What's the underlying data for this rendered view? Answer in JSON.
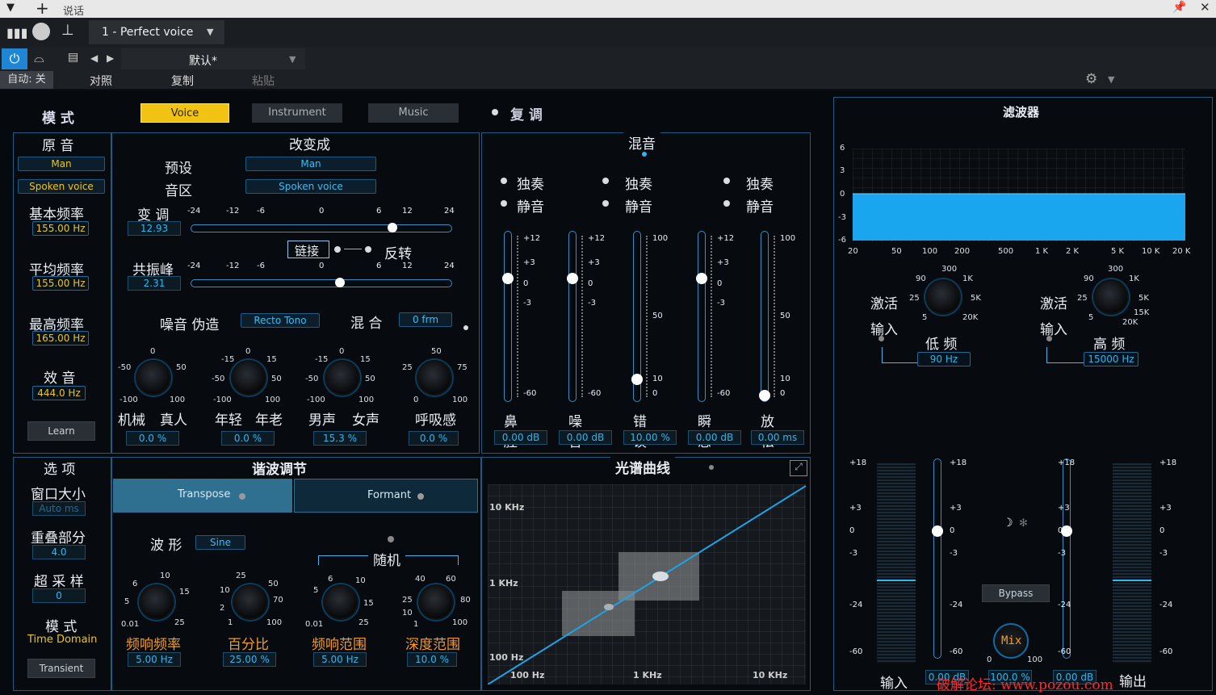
{
  "titlebar": {
    "title": "说话"
  },
  "toolbar": {
    "preset_slot": "1 - Perfect voice",
    "preset_name": "默认*",
    "auto": "自动: 关",
    "compare": "对照",
    "copy": "复制",
    "paste": "粘贴"
  },
  "mode": {
    "label": "模 式",
    "tabs": [
      "Voice",
      "Instrument",
      "Music"
    ],
    "active": "Voice",
    "reset": "复 调"
  },
  "source": {
    "title": "原 音",
    "gender": "Man",
    "type": "Spoken voice",
    "fields": [
      {
        "label": "基本频率",
        "value": "155.00 Hz"
      },
      {
        "label": "平均频率",
        "value": "155.00 Hz"
      },
      {
        "label": "最高频率",
        "value": "165.00 Hz"
      },
      {
        "label": "效 音",
        "value": "444.0 Hz"
      }
    ],
    "learn": "Learn"
  },
  "target": {
    "title": "改变成",
    "preset_label": "预设",
    "preset": "Man",
    "range_label": "音区",
    "range": "Spoken voice",
    "pitch_label": "变 调",
    "pitch_value": "12.93",
    "formant_label": "共振峰",
    "formant_value": "2.31",
    "ticks": [
      "-24",
      "-12",
      "-6",
      "0",
      "6",
      "12",
      "24"
    ],
    "link": "链接",
    "invert": "反转",
    "noise_label": "噪音 伪造",
    "noise_value": "Recto Tono",
    "mix_label": "混 合",
    "mix_value": "0 frm",
    "pitch_fraction": 0.78,
    "formant_fraction": 0.57,
    "knobs": [
      {
        "ticks": [
          "0",
          "-50",
          "50",
          "-100",
          "100"
        ],
        "left": "机械",
        "right": "真人",
        "value": "0.0 %"
      },
      {
        "ticks": [
          "0",
          "-15",
          "15",
          "-50",
          "50",
          "-100",
          "100"
        ],
        "left": "年轻",
        "right": "年老",
        "value": "0.0 %"
      },
      {
        "ticks": [
          "0",
          "-15",
          "15",
          "-50",
          "50",
          "-100",
          "100"
        ],
        "left": "男声",
        "right": "女声",
        "value": "15.3 %"
      },
      {
        "ticks": [
          "50",
          "25",
          "75",
          "0",
          "100"
        ],
        "left": "",
        "right": "呼吸感",
        "value": "0.0 %"
      }
    ]
  },
  "mixer": {
    "title": "混音",
    "solo": "独奏",
    "mute": "静音",
    "channels": [
      {
        "label": "鼻腔",
        "value": "0.00 dB",
        "ticks": [
          "+12",
          "+3",
          "0",
          "-3",
          "-60"
        ],
        "level": 0.74
      },
      {
        "label": "噪音",
        "value": "0.00 dB",
        "ticks": [
          "+12",
          "+3",
          "0",
          "-3",
          "-60"
        ],
        "level": 0.74
      },
      {
        "label": "错误",
        "value": "10.00 %",
        "ticks": [
          "100",
          "50",
          "10",
          "0"
        ],
        "level": 0.1
      },
      {
        "label": "瞬态",
        "value": "0.00 dB",
        "ticks": [
          "+12",
          "+3",
          "0",
          "-3",
          "-60"
        ],
        "level": 0.74
      },
      {
        "label": "放松",
        "value": "0.00 ms",
        "ticks": [
          "100",
          "50",
          "10",
          "0"
        ],
        "level": 0.0
      }
    ]
  },
  "options": {
    "title": "选 项",
    "window": "窗口大小",
    "window_value": "Auto ms",
    "overlap": "重叠部分",
    "overlap_value": "4.0",
    "oversample": "超 采 样",
    "oversample_value": "0",
    "mode": "模 式",
    "mode_value": "Time Domain",
    "transient": "Transient"
  },
  "harmonic": {
    "title": "谐波调节",
    "tabs": [
      "Transpose",
      "Formant"
    ],
    "wave_label": "波 形",
    "wave": "Sine",
    "random": "随机",
    "knobs": [
      {
        "ticks": [
          "10",
          "6",
          "15",
          "5",
          "0.01",
          "25"
        ],
        "label": "频响频率",
        "value": "5.00 Hz"
      },
      {
        "ticks": [
          "25",
          "10",
          "50",
          "70",
          "2",
          "1",
          "100"
        ],
        "label": "百分比",
        "value": "25.00 %"
      },
      {
        "ticks": [
          "6",
          "10",
          "5",
          "15",
          "0.01",
          "25"
        ],
        "label": "频响范围",
        "value": "5.00 Hz"
      },
      {
        "ticks": [
          "40",
          "60",
          "25",
          "80",
          "10",
          "1",
          "100"
        ],
        "label": "深度范围",
        "value": "10.0 %"
      }
    ]
  },
  "spectrum": {
    "title": "光谱曲线",
    "y_labels": [
      "10 KHz",
      "1 KHz",
      "100 Hz"
    ],
    "x_labels": [
      "100 Hz",
      "1 KHz",
      "10 KHz"
    ]
  },
  "filter": {
    "title": "滤波器",
    "y_labels": [
      "6",
      "3",
      "0",
      "-3",
      "-6"
    ],
    "x_labels": [
      "20",
      "50",
      "100",
      "200",
      "500",
      "1 K",
      "2 K",
      "5 K",
      "10 K",
      "20 K"
    ],
    "low": {
      "activate": "激活",
      "input": "输入",
      "label": "低 频",
      "value": "90 Hz",
      "ticks": [
        "300",
        "1K",
        "90",
        "25",
        "5K",
        "5",
        "20K"
      ]
    },
    "high": {
      "activate": "激活",
      "input": "输入",
      "label": "高 频",
      "value": "15000 Hz",
      "ticks": [
        "300",
        "1K",
        "90",
        "25",
        "5K",
        "15K",
        "5",
        "20K"
      ]
    },
    "meter_ticks": [
      "+18",
      "+3",
      "0",
      "-3",
      "-24",
      "-60"
    ],
    "input_label": "输入",
    "output_label": "输出",
    "in_value": "0.00 dB",
    "out_value": "0.00 dB",
    "bypass": "Bypass",
    "mix": "Mix",
    "mix_ticks": [
      "0",
      "100"
    ],
    "mix_value": "100.0 %"
  },
  "watermark": "破解论坛: www.pozou.com"
}
